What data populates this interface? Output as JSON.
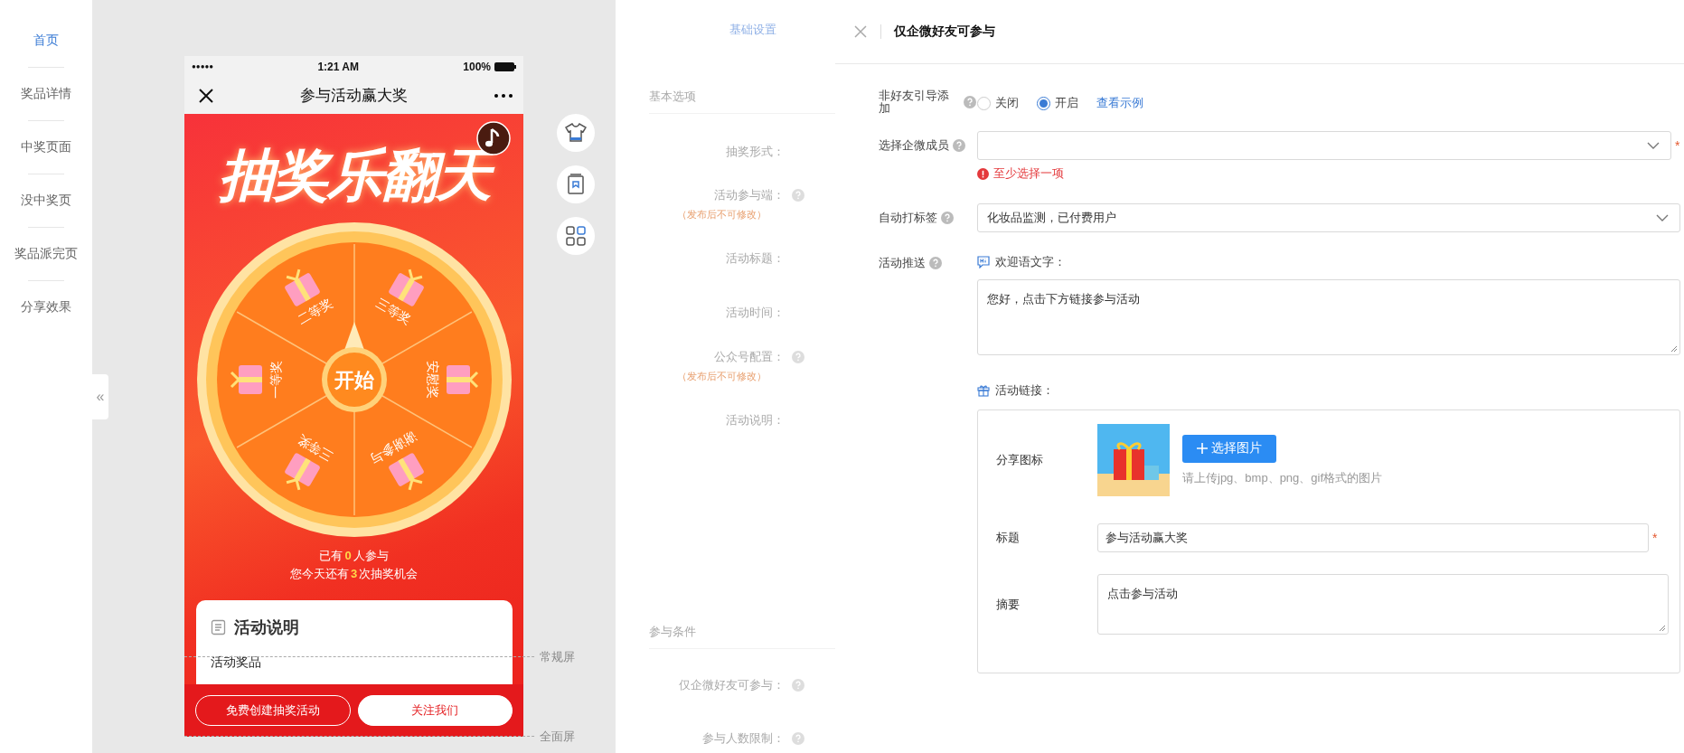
{
  "sidebar": {
    "items": [
      {
        "label": "首页",
        "selected": true
      },
      {
        "label": "奖品详情",
        "selected": false
      },
      {
        "label": "中奖页面",
        "selected": false
      },
      {
        "label": "没中奖页",
        "selected": false
      },
      {
        "label": "奖品派完页",
        "selected": false
      },
      {
        "label": "分享效果",
        "selected": false
      }
    ]
  },
  "collapse_button": {
    "label": "«"
  },
  "phone": {
    "status_bar": {
      "signal": "●●●●●",
      "time": "1:21 AM",
      "battery": "100%"
    },
    "nav": {
      "title": "参与活动赢大奖"
    },
    "banner_title": "抽奖乐翻天",
    "wheel": {
      "start": "开始",
      "segments": [
        {
          "label": "二等奖"
        },
        {
          "label": "三等奖"
        },
        {
          "label": "安慰奖"
        },
        {
          "label": "谢谢参与"
        },
        {
          "label": "三等奖"
        },
        {
          "label": "一等奖"
        }
      ]
    },
    "stats": [
      {
        "before": "已有",
        "count": "0",
        "after": "人参与"
      },
      {
        "before": "您今天还有",
        "count": "3",
        "after": "次抽奖机会"
      }
    ],
    "info_card": {
      "title": "活动说明",
      "subtitle": "活动奖品"
    },
    "buttons": [
      {
        "label": "免费创建抽奖活动",
        "kind": "outline"
      },
      {
        "label": "关注我们",
        "kind": "solid"
      }
    ]
  },
  "screen_markers": [
    "常规屏",
    "全面屏"
  ],
  "settings": {
    "tab": "基础设置",
    "sections": [
      {
        "title": "基本选项",
        "fields": [
          {
            "label": "抽奖形式：",
            "help": false
          },
          {
            "label": "活动参与端：",
            "help": true,
            "note": "（发布后不可修改）"
          },
          {
            "label": "活动标题：",
            "help": false
          },
          {
            "label": "活动时间：",
            "help": false
          },
          {
            "label": "公众号配置：",
            "help": true,
            "note": "（发布后不可修改）"
          },
          {
            "label": "活动说明：",
            "help": false
          }
        ]
      },
      {
        "title": "参与条件",
        "fields": [
          {
            "label": "仅企微好友可参与：",
            "help": true
          },
          {
            "label": "参与人数限制：",
            "help": true
          }
        ]
      }
    ]
  },
  "drawer": {
    "title": "仅企微好友可参与",
    "guide": {
      "label": "非好友引导添加",
      "options": [
        {
          "label": "关闭",
          "selected": false
        },
        {
          "label": "开启",
          "selected": true
        }
      ],
      "link": "查看示例"
    },
    "member_select": {
      "label": "选择企微成员",
      "required_mark": "*",
      "error": "至少选择一项"
    },
    "tag_select": {
      "label": "自动打标签",
      "value": "化妆品监测，已付费用户"
    },
    "push": {
      "label": "活动推送",
      "welcome_label": "欢迎语文字：",
      "welcome_text": "您好，点击下方链接参与活动",
      "link_label": "活动链接：",
      "share_icon": {
        "label": "分享图标",
        "button": "选择图片",
        "hint": "请上传jpg、bmp、png、gif格式的图片"
      },
      "title_field": {
        "label": "标题",
        "value": "参与活动赢大奖",
        "required_mark": "*"
      },
      "summary_field": {
        "label": "摘要",
        "value": "点击参与活动"
      }
    }
  }
}
